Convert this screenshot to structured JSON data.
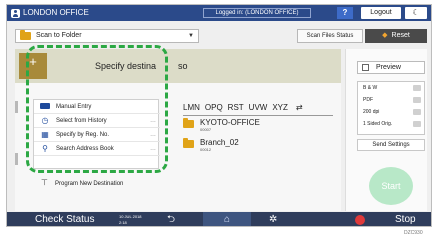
{
  "header": {
    "office": "LONDON OFFICE",
    "login_status": "Logged in: (LONDON OFFICE)",
    "help": "?",
    "logout": "Logout",
    "moon": "☾"
  },
  "toolbar": {
    "destination_label": "Scan to Folder",
    "scan_files_status": "Scan Files Status",
    "reset": "Reset"
  },
  "destination": {
    "specify_prefix": "Specify destina",
    "specify_suffix": "so",
    "index_tabs": [
      "LMN",
      "OPQ",
      "RST",
      "UVW",
      "XYZ"
    ],
    "entries": [
      {
        "name": "KYOTO-OFFICE",
        "number": "00007"
      },
      {
        "name": "Branch_02",
        "number": "00012"
      }
    ]
  },
  "menu": {
    "items": [
      {
        "label": "Manual Entry",
        "icon": "keyboard-icon"
      },
      {
        "label": "Select from History",
        "icon": "history-icon"
      },
      {
        "label": "Specify by Reg. No.",
        "icon": "registration-number-icon"
      },
      {
        "label": "Search Address Book",
        "icon": "search-icon"
      }
    ],
    "program": "Program New Destination"
  },
  "right_panel": {
    "preview": "Preview",
    "settings": [
      "B & W",
      "PDF",
      "200 dpi",
      "1 Sided Orig."
    ],
    "send_settings": "Send Settings",
    "start": "Start"
  },
  "bottom_bar": {
    "check_status": "Check Status",
    "date": "10 JUL 2018",
    "time": "2:18",
    "stop": "Stop"
  },
  "caption": "DZC930",
  "colors": {
    "header": "#2b4a8a",
    "highlight": "#2ca844",
    "start": "#b8e8c8",
    "stop": "#e03a3a"
  }
}
